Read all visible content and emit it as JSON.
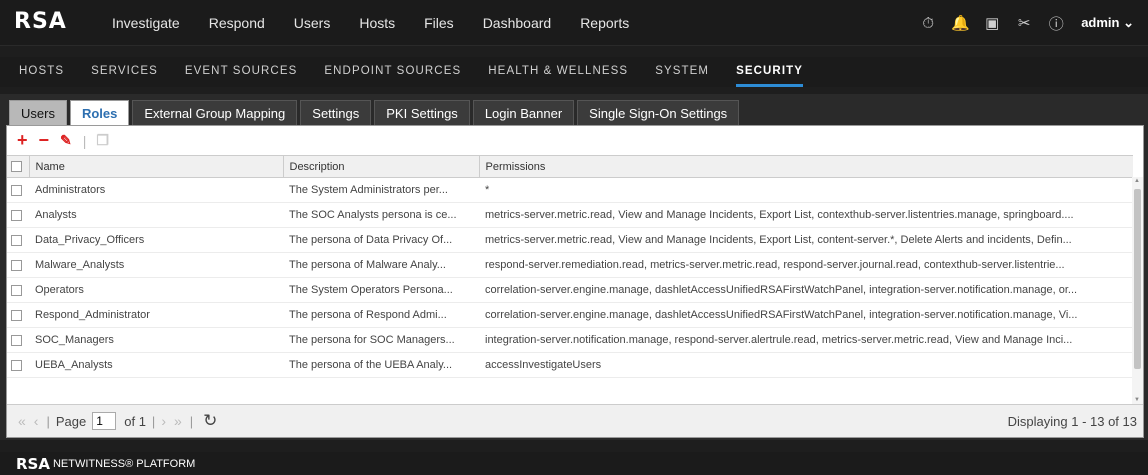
{
  "brand": {
    "logo": "RSA"
  },
  "topnav": [
    "Investigate",
    "Respond",
    "Users",
    "Hosts",
    "Files",
    "Dashboard",
    "Reports"
  ],
  "user": {
    "name": "admin ⌄"
  },
  "subnav": [
    "HOSTS",
    "SERVICES",
    "EVENT SOURCES",
    "ENDPOINT SOURCES",
    "HEALTH & WELLNESS",
    "SYSTEM",
    "SECURITY"
  ],
  "tabs": [
    "Users",
    "Roles",
    "External Group Mapping",
    "Settings",
    "PKI Settings",
    "Login Banner",
    "Single Sign-On Settings"
  ],
  "table": {
    "headers": [
      "Name",
      "Description",
      "Permissions"
    ],
    "rows": [
      [
        "Administrators",
        "The System Administrators per...",
        "*"
      ],
      [
        "Analysts",
        "The SOC Analysts persona is ce...",
        "metrics-server.metric.read, View and Manage Incidents, Export List, contexthub-server.listentries.manage, springboard...."
      ],
      [
        "Data_Privacy_Officers",
        "The persona of Data Privacy Of...",
        "metrics-server.metric.read, View and Manage Incidents, Export List, content-server.*, Delete Alerts and incidents, Defin..."
      ],
      [
        "Malware_Analysts",
        "The persona of Malware Analy...",
        "respond-server.remediation.read, metrics-server.metric.read, respond-server.journal.read, contexthub-server.listentrie..."
      ],
      [
        "Operators",
        "The System Operators Persona...",
        "correlation-server.engine.manage, dashletAccessUnifiedRSAFirstWatchPanel, integration-server.notification.manage, or..."
      ],
      [
        "Respond_Administrator",
        "The persona of Respond Admi...",
        "correlation-server.engine.manage, dashletAccessUnifiedRSAFirstWatchPanel, integration-server.notification.manage, Vi..."
      ],
      [
        "SOC_Managers",
        "The persona for SOC Managers...",
        "integration-server.notification.manage, respond-server.alertrule.read, metrics-server.metric.read, View and Manage Inci..."
      ],
      [
        "UEBA_Analysts",
        "The persona of the UEBA Analy...",
        "accessInvestigateUsers"
      ]
    ]
  },
  "pager": {
    "page_label": "Page",
    "page_value": "1",
    "of_label": "of 1",
    "display": "Displaying 1 - 13 of 13"
  },
  "footer": {
    "rsa": "RSA",
    "platform": "NETWITNESS® PLATFORM"
  }
}
